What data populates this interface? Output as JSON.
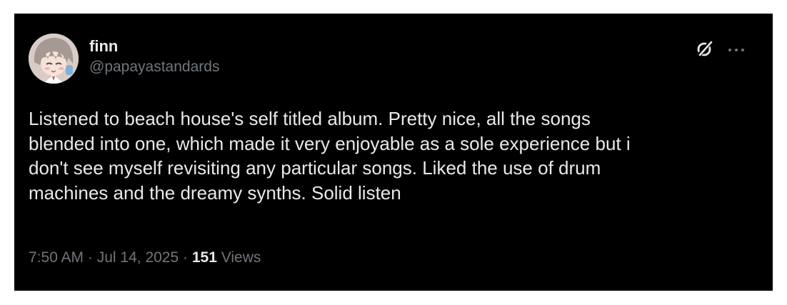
{
  "post": {
    "author": {
      "display_name": "finn",
      "handle": "@papayastandards",
      "avatar_icon": "anime-character-avatar"
    },
    "text": "Listened to beach house's self titled album. Pretty nice, all the songs\nblended into one, which made it very enjoyable as a sole experience but i\ndon't see myself revisiting any particular songs. Liked the use of drum\nmachines and the dreamy synths. Solid listen",
    "time": "7:50 AM",
    "separator": " · ",
    "date": "Jul 14, 2025",
    "views_count": "151",
    "views_label": " Views"
  },
  "icons": {
    "grok": "grok-icon",
    "more": "more-options-icon"
  },
  "colors": {
    "background": "#000000",
    "primary_text": "#e7e9ea",
    "secondary_text": "#71767b"
  }
}
